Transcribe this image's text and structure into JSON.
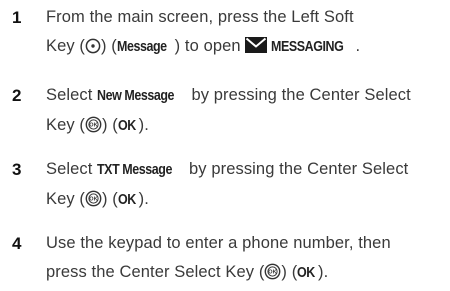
{
  "steps": [
    {
      "number": "1",
      "line1": "From the main screen, press the Left Soft",
      "line2_pre": "Key (",
      "line2_mid": ") (",
      "line2_bold": "Message",
      "line2_post": ") to open ",
      "line2_bold2": "MESSAGING",
      "line2_end": "."
    },
    {
      "number": "2",
      "line1_pre": "Select ",
      "line1_bold": "New Message",
      "line1_post": " by pressing the Center Select",
      "line2_pre": "Key (",
      "line2_mid": ") (",
      "line2_bold": "OK",
      "line2_end": ")."
    },
    {
      "number": "3",
      "line1_pre": "Select ",
      "line1_bold": "TXT Message",
      "line1_post": " by pressing the Center Select",
      "line2_pre": "Key (",
      "line2_mid": ") (",
      "line2_bold": "OK",
      "line2_end": ")."
    },
    {
      "number": "4",
      "line1": "Use the keypad to enter a phone number, then",
      "line2_pre": "press the Center Select Key (",
      "line2_mid": ") (",
      "line2_bold": "OK",
      "line2_end": ")."
    }
  ]
}
